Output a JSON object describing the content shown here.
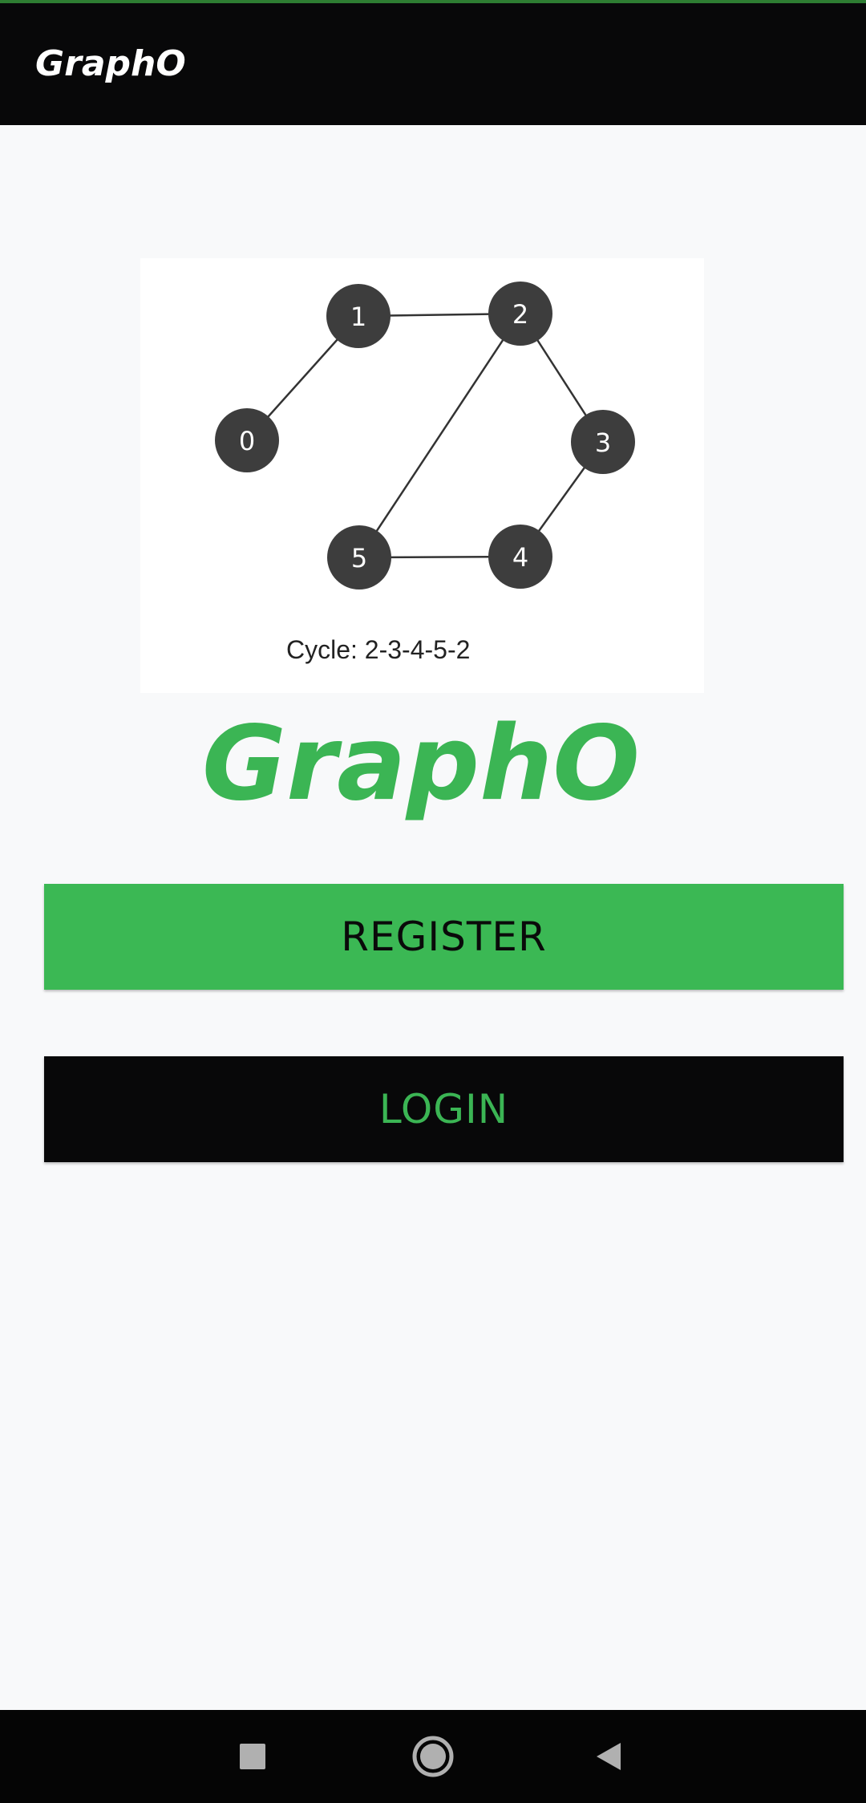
{
  "app_bar": {
    "title": "GraphO"
  },
  "illustration": {
    "nodes": [
      {
        "label": "0"
      },
      {
        "label": "1"
      },
      {
        "label": "2"
      },
      {
        "label": "3"
      },
      {
        "label": "4"
      },
      {
        "label": "5"
      }
    ],
    "edges": [
      [
        "0",
        "1"
      ],
      [
        "1",
        "2"
      ],
      [
        "2",
        "3"
      ],
      [
        "2",
        "5"
      ],
      [
        "3",
        "4"
      ],
      [
        "4",
        "5"
      ]
    ],
    "caption": "Cycle: 2-3-4-5-2"
  },
  "brand": {
    "title": "GraphO"
  },
  "actions": {
    "register_label": "REGISTER",
    "login_label": "LOGIN"
  },
  "navigation": {
    "recent_icon": "square-icon",
    "home_icon": "circle-icon",
    "back_icon": "triangle-icon"
  },
  "colors": {
    "accent_green": "#3bb554",
    "app_bar_bg": "#080809",
    "page_bg": "#f8f9fa",
    "node_fill": "#3d3d3d"
  }
}
